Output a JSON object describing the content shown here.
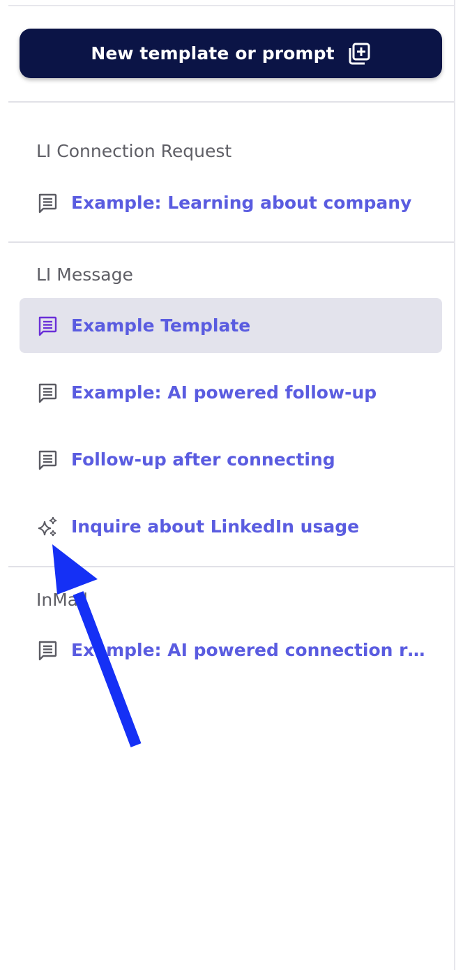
{
  "new_button": {
    "label": "New template or prompt",
    "icon": "add-copy-icon"
  },
  "sections": [
    {
      "title": "LI Connection Request",
      "items": [
        {
          "label": "Example: Learning about company",
          "icon": "message-icon",
          "active": false
        }
      ]
    },
    {
      "title": "LI Message",
      "items": [
        {
          "label": "Example Template",
          "icon": "message-icon",
          "active": true
        },
        {
          "label": "Example: AI powered follow-up",
          "icon": "message-icon",
          "active": false
        },
        {
          "label": "Follow-up after connecting",
          "icon": "message-icon",
          "active": false
        },
        {
          "label": "Inquire about LinkedIn usage",
          "icon": "sparkles-icon",
          "active": false
        }
      ]
    },
    {
      "title": "InMail",
      "items": [
        {
          "label": "Example: AI powered connection req...",
          "icon": "message-icon",
          "active": false
        }
      ]
    }
  ],
  "colors": {
    "primary_button": "#0b1446",
    "link_text": "#5a5ce0",
    "active_bg": "#e3e3ec",
    "active_icon": "#6a2fd8",
    "icon_gray": "#5b5b63",
    "arrow": "#1530f5"
  },
  "annotation": {
    "icon": "pointer-arrow-icon"
  }
}
